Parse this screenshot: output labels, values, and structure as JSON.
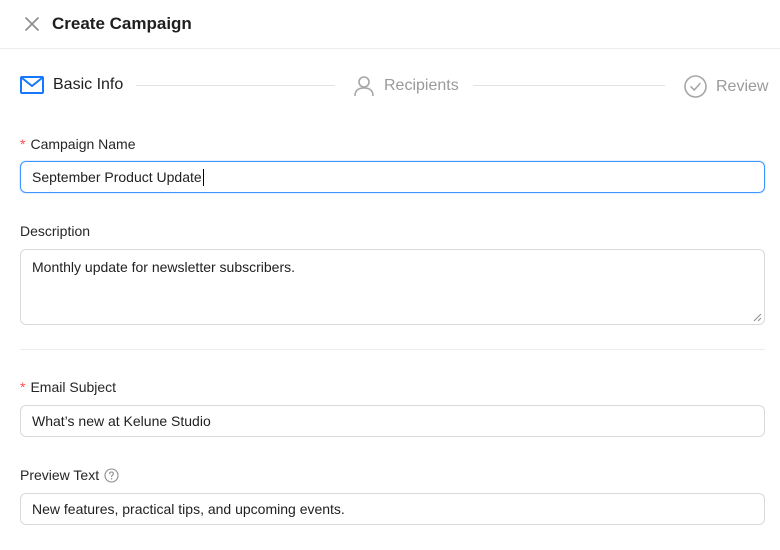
{
  "header": {
    "title": "Create Campaign"
  },
  "steps": [
    {
      "label": "Basic Info",
      "icon": "mail-icon",
      "state": "active"
    },
    {
      "label": "Recipients",
      "icon": "user-icon",
      "state": "inactive"
    },
    {
      "label": "Review",
      "icon": "check-circle-icon",
      "state": "inactive"
    }
  ],
  "form": {
    "campaign_name": {
      "label": "Campaign Name",
      "required_mark": "*",
      "value": "September Product Update"
    },
    "description": {
      "label": "Description",
      "value": "Monthly update for newsletter subscribers."
    },
    "email_subject": {
      "label": "Email Subject",
      "required_mark": "*",
      "value": "What’s new at Kelune Studio"
    },
    "preview_text": {
      "label": "Preview Text",
      "help_icon": "question-circle-icon",
      "value": "New features, practical tips, and upcoming events."
    }
  },
  "colors": {
    "accent": "#1677ff",
    "required": "#ff4d4f",
    "focus_border": "#4096ff",
    "muted": "#9a9a9a",
    "border": "#d9d9d9"
  }
}
